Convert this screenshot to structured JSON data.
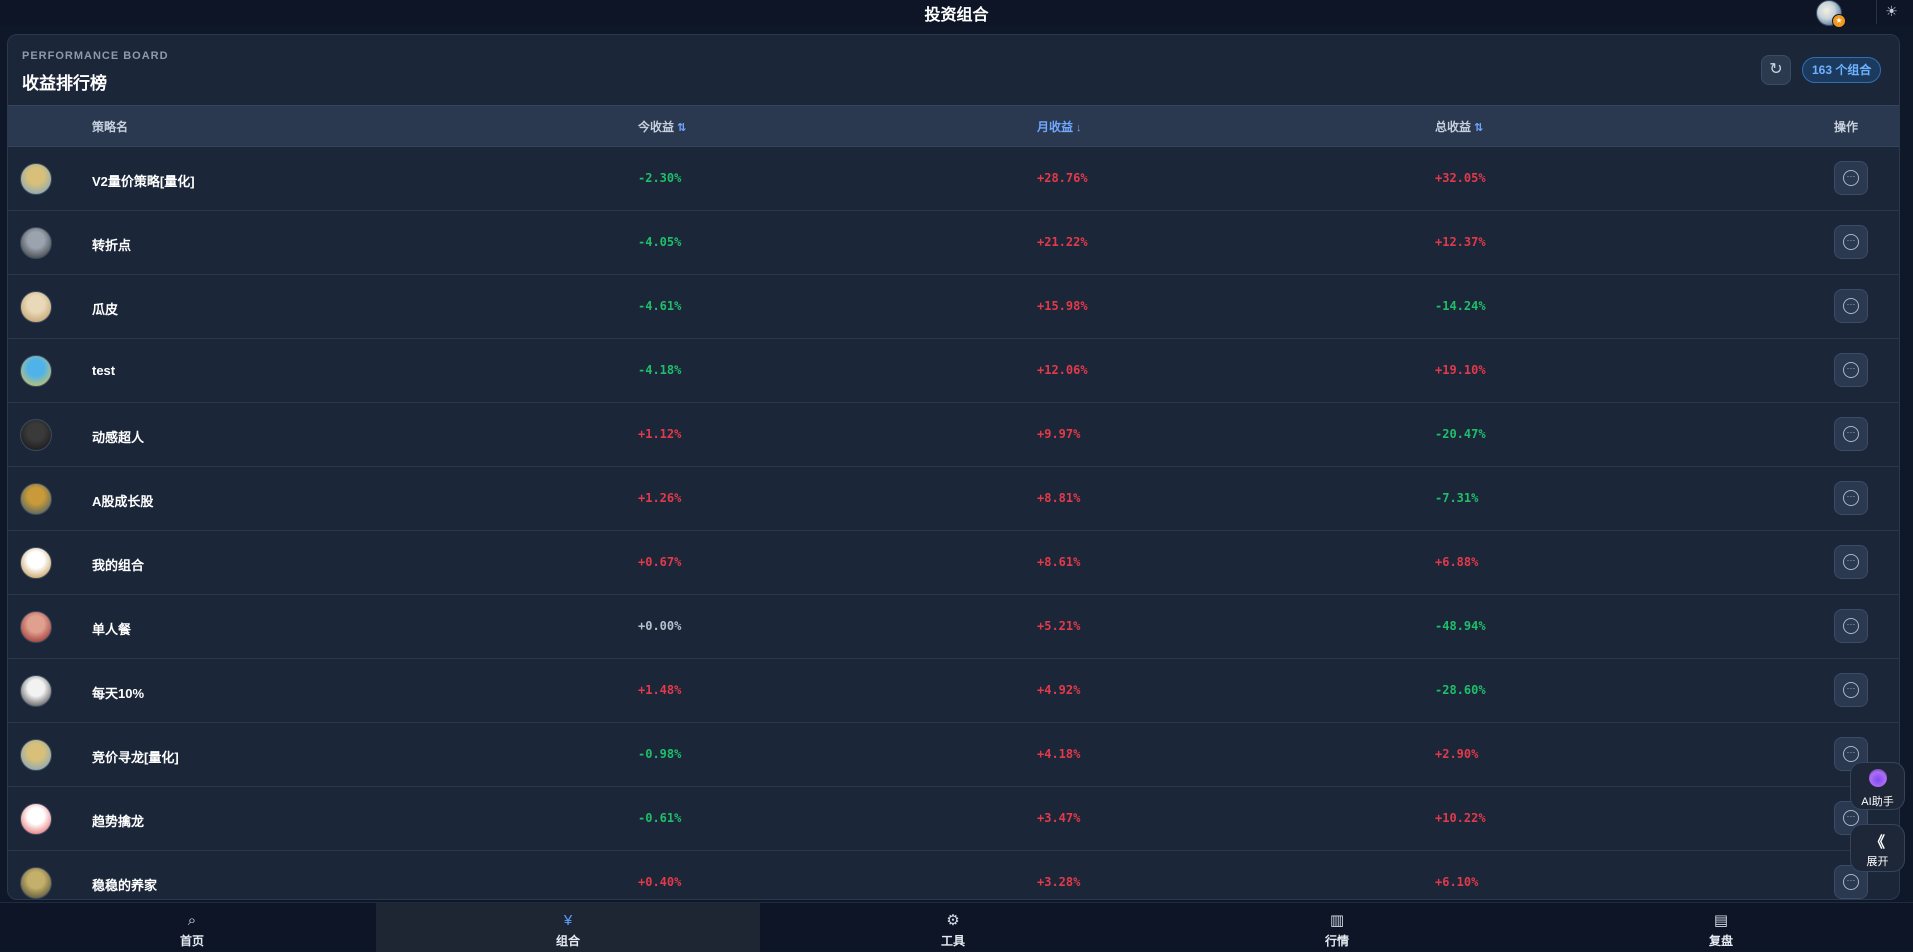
{
  "app": {
    "title": "投资组合"
  },
  "panel": {
    "eyebrow": "PERFORMANCE BOARD",
    "title": "收益排行榜",
    "count_badge": "163 个组合"
  },
  "table": {
    "columns": {
      "name": "策略名",
      "today": "今收益",
      "month": "月收益",
      "total": "总收益",
      "action": "操作"
    },
    "sort_active": "月收益",
    "rows": [
      {
        "name": "V2量价策略[量化]",
        "today": "-2.30%",
        "month": "+28.76%",
        "total": "+32.05%",
        "today_dir": "down",
        "month_dir": "up",
        "total_dir": "up",
        "avatar_colors": [
          "#d8c07a",
          "#6d9fcf"
        ]
      },
      {
        "name": "转折点",
        "today": "-4.05%",
        "month": "+21.22%",
        "total": "+12.37%",
        "today_dir": "down",
        "month_dir": "up",
        "total_dir": "up",
        "avatar_colors": [
          "#9aa3ae",
          "#2a2a2a"
        ]
      },
      {
        "name": "瓜皮",
        "today": "-4.61%",
        "month": "+15.98%",
        "total": "-14.24%",
        "today_dir": "down",
        "month_dir": "up",
        "total_dir": "down",
        "avatar_colors": [
          "#e9d9b8",
          "#b9925a"
        ]
      },
      {
        "name": "test",
        "today": "-4.18%",
        "month": "+12.06%",
        "total": "+19.10%",
        "today_dir": "down",
        "month_dir": "up",
        "total_dir": "up",
        "avatar_colors": [
          "#4fb3ea",
          "#f2c53d"
        ]
      },
      {
        "name": "动感超人",
        "today": "+1.12%",
        "month": "+9.97%",
        "total": "-20.47%",
        "today_dir": "up",
        "month_dir": "up",
        "total_dir": "down",
        "avatar_colors": [
          "#3a3a3a",
          "#121212"
        ]
      },
      {
        "name": "A股成长股",
        "today": "+1.26%",
        "month": "+8.81%",
        "total": "-7.31%",
        "today_dir": "up",
        "month_dir": "up",
        "total_dir": "down",
        "avatar_colors": [
          "#c89a3a",
          "#2d5470"
        ]
      },
      {
        "name": "我的组合",
        "today": "+0.67%",
        "month": "+8.61%",
        "total": "+6.88%",
        "today_dir": "up",
        "month_dir": "up",
        "total_dir": "up",
        "avatar_colors": [
          "#ffffff",
          "#b9822e"
        ]
      },
      {
        "name": "单人餐",
        "today": "+0.00%",
        "month": "+5.21%",
        "total": "-48.94%",
        "today_dir": "flat",
        "month_dir": "up",
        "total_dir": "down",
        "avatar_colors": [
          "#e0a090",
          "#8b1a1a"
        ]
      },
      {
        "name": "每天10%",
        "today": "+1.48%",
        "month": "+4.92%",
        "total": "-28.60%",
        "today_dir": "up",
        "month_dir": "up",
        "total_dir": "down",
        "avatar_colors": [
          "#f2f2f2",
          "#2b2b2b"
        ]
      },
      {
        "name": "竞价寻龙[量化]",
        "today": "-0.98%",
        "month": "+4.18%",
        "total": "+2.90%",
        "today_dir": "down",
        "month_dir": "up",
        "total_dir": "up",
        "avatar_colors": [
          "#d8c07a",
          "#6d9fcf"
        ]
      },
      {
        "name": "趋势擒龙",
        "today": "-0.61%",
        "month": "+3.47%",
        "total": "+10.22%",
        "today_dir": "down",
        "month_dir": "up",
        "total_dir": "up",
        "avatar_colors": [
          "#ffffff",
          "#e24a4a"
        ]
      },
      {
        "name": "稳稳的养家",
        "today": "+0.40%",
        "month": "+3.28%",
        "total": "+6.10%",
        "today_dir": "up",
        "month_dir": "up",
        "total_dir": "up",
        "avatar_colors": [
          "#c4b06a",
          "#3c3a2a"
        ]
      }
    ]
  },
  "floating": {
    "ai_label": "AI助手",
    "expand_label": "展开"
  },
  "bottom_nav": {
    "active": "组合",
    "items": [
      {
        "label": "首页",
        "icon": "search-icon"
      },
      {
        "label": "组合",
        "icon": "yuan-icon"
      },
      {
        "label": "工具",
        "icon": "gear-icon"
      },
      {
        "label": "行情",
        "icon": "chart-icon"
      },
      {
        "label": "复盘",
        "icon": "notes-icon"
      }
    ]
  },
  "colors": {
    "up": "#e23a4a",
    "down": "#1fbf6a",
    "accent": "#6fa8ff"
  }
}
